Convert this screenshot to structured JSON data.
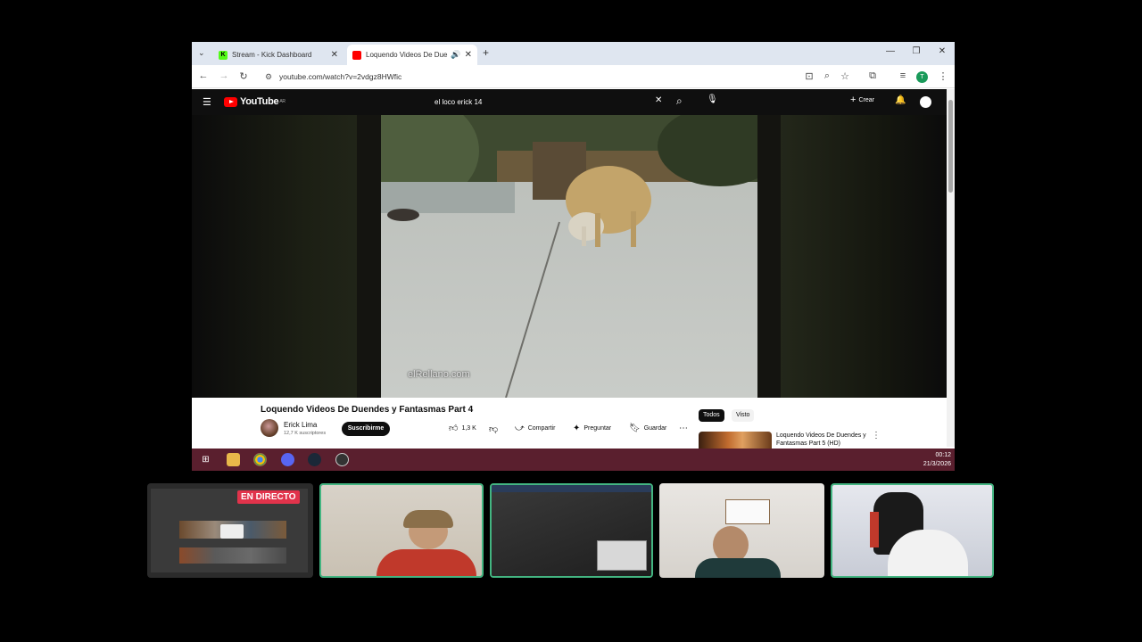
{
  "browser": {
    "tabs": [
      {
        "title": "Stream - Kick Dashboard",
        "active": false,
        "favicon_color": "#53fc18"
      },
      {
        "title": "Loquendo Videos De Duendes",
        "active": true,
        "favicon_color": "#ff0000"
      }
    ],
    "new_tab_icon": "plus-icon",
    "url": "youtube.com/watch?v=2vdgz8HWfic",
    "profile_initial": "T"
  },
  "youtube": {
    "logo_text": "YouTube",
    "logo_region": "AR",
    "search_value": "el loco erick 14",
    "create_label": "Crear",
    "video": {
      "watermark": "elRellano.com",
      "title": "Loquendo Videos De Duendes y Fantasmas Part 4"
    },
    "channel": {
      "name": "Erick Lima",
      "subscribers": "12,7 K suscriptores",
      "subscribe_label": "Suscribirme"
    },
    "actions": {
      "likes": "1,3 K",
      "share": "Compartir",
      "ask": "Preguntar",
      "save": "Guardar"
    },
    "chips": [
      "Todos",
      "Visto"
    ],
    "related": {
      "title": "Loquendo Videos De Duendes y Fantasmas Part 5 (HD)"
    }
  },
  "taskbar": {
    "time": "00:12",
    "date": "21/3/2026"
  },
  "stream": {
    "live_label": "EN DIRECTO"
  },
  "colors": {
    "taskbar": "#5a1f2e",
    "active_speaker_border": "#43b581",
    "live_badge": "#e1334b",
    "youtube_red": "#ff0000"
  }
}
